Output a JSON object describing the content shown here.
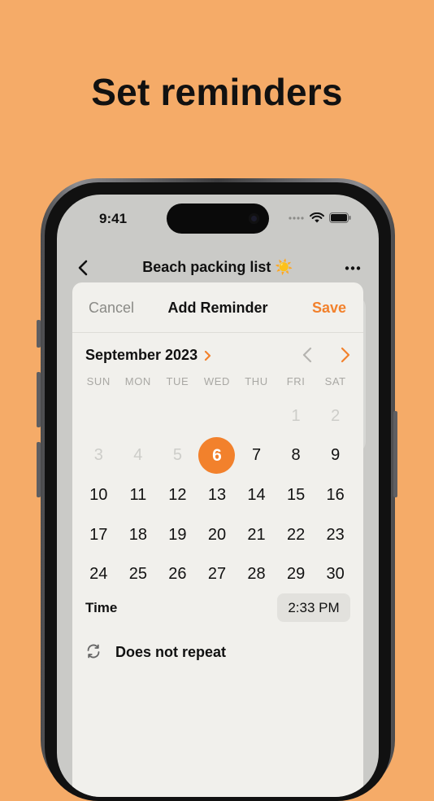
{
  "headline": "Set reminders",
  "status_bar": {
    "time": "9:41"
  },
  "nav": {
    "title": "Beach packing list ☀️"
  },
  "sheet": {
    "cancel_label": "Cancel",
    "title": "Add Reminder",
    "save_label": "Save"
  },
  "calendar": {
    "month_label": "September 2023",
    "weekdays": [
      "SUN",
      "MON",
      "TUE",
      "WED",
      "THU",
      "FRI",
      "SAT"
    ],
    "days": [
      {
        "label": "",
        "state": "blank"
      },
      {
        "label": "",
        "state": "blank"
      },
      {
        "label": "",
        "state": "blank"
      },
      {
        "label": "",
        "state": "blank"
      },
      {
        "label": "",
        "state": "blank"
      },
      {
        "label": "1",
        "state": "disabled"
      },
      {
        "label": "2",
        "state": "disabled"
      },
      {
        "label": "3",
        "state": "disabled"
      },
      {
        "label": "4",
        "state": "disabled"
      },
      {
        "label": "5",
        "state": "disabled"
      },
      {
        "label": "6",
        "state": "selected"
      },
      {
        "label": "7",
        "state": "normal"
      },
      {
        "label": "8",
        "state": "normal"
      },
      {
        "label": "9",
        "state": "normal"
      },
      {
        "label": "10",
        "state": "normal"
      },
      {
        "label": "11",
        "state": "normal"
      },
      {
        "label": "12",
        "state": "normal"
      },
      {
        "label": "13",
        "state": "normal"
      },
      {
        "label": "14",
        "state": "normal"
      },
      {
        "label": "15",
        "state": "normal"
      },
      {
        "label": "16",
        "state": "normal"
      },
      {
        "label": "17",
        "state": "normal"
      },
      {
        "label": "18",
        "state": "normal"
      },
      {
        "label": "19",
        "state": "normal"
      },
      {
        "label": "20",
        "state": "normal"
      },
      {
        "label": "21",
        "state": "normal"
      },
      {
        "label": "22",
        "state": "normal"
      },
      {
        "label": "23",
        "state": "normal"
      },
      {
        "label": "24",
        "state": "normal"
      },
      {
        "label": "25",
        "state": "normal"
      },
      {
        "label": "26",
        "state": "normal"
      },
      {
        "label": "27",
        "state": "normal"
      },
      {
        "label": "28",
        "state": "normal"
      },
      {
        "label": "29",
        "state": "normal"
      },
      {
        "label": "30",
        "state": "normal"
      }
    ]
  },
  "time": {
    "label": "Time",
    "value": "2:33 PM"
  },
  "repeat": {
    "label": "Does not repeat"
  },
  "colors": {
    "background": "#F5AB68",
    "accent": "#F2812C",
    "sheet": "#F1F0EC"
  },
  "icons": [
    "back-chevron-icon",
    "more-icon",
    "chevron-right-icon",
    "chevron-left-icon",
    "repeat-icon",
    "wifi-icon",
    "battery-icon",
    "signal-icon"
  ]
}
